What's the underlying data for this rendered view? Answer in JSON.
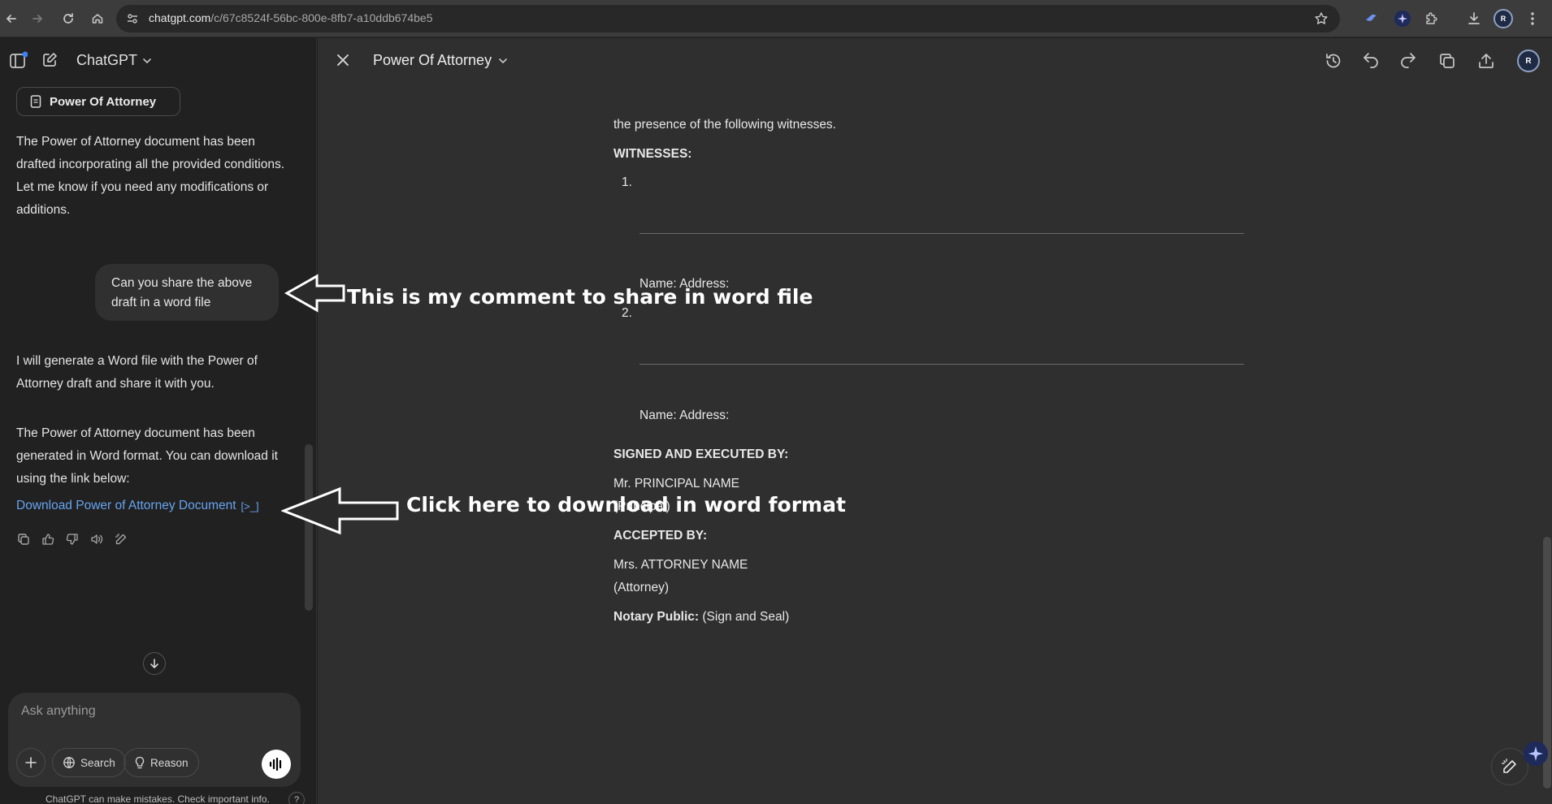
{
  "browser": {
    "url_host": "chatgpt.com",
    "url_path": "/c/67c8524f-56bc-800e-8fb7-a10ddb674be5"
  },
  "sidebar": {
    "app_title": "ChatGPT",
    "doc_chip_label": "Power Of Attorney",
    "assistant_msg_1": "The Power of Attorney document has been drafted incorporating all the provided conditions. Let me know if you need any modifications or additions.",
    "user_msg": "Can you share the above draft in a word file",
    "assistant_msg_2": "I will generate a Word file with the Power of Attorney draft and share it with you.",
    "assistant_msg_3": "The Power of Attorney document has been generated in Word format. You can download it using the link below:",
    "download_link": "Download Power of Attorney Document",
    "download_link_suffix": "[>_]"
  },
  "composer": {
    "placeholder": "Ask anything",
    "search_label": "Search",
    "reason_label": "Reason",
    "disclaimer": "ChatGPT can make mistakes. Check important info.",
    "help": "?"
  },
  "canvas": {
    "title": "Power Of Attorney",
    "doc": {
      "intro_line": "the presence of the following witnesses.",
      "witnesses_heading": "WITNESSES:",
      "item1": "1.",
      "name_address_1": "Name: Address:",
      "item2": "2.",
      "name_address_2": "Name: Address:",
      "signed_heading": "SIGNED AND EXECUTED BY:",
      "principal_name": "Mr. PRINCIPAL NAME",
      "principal_role": "(Principal)",
      "accepted_heading": "ACCEPTED BY:",
      "attorney_name": "Mrs. ATTORNEY NAME",
      "attorney_role": "(Attorney)",
      "notary_label": "Notary Public:",
      "notary_value": " (Sign and Seal)"
    }
  },
  "annotations": {
    "comment_1": "This is my comment to share in word file",
    "comment_2": "Click here to download in word format"
  },
  "colors": {
    "link": "#66a4f0",
    "sidebar_bg": "#212121",
    "canvas_bg": "#2f2f2f"
  }
}
